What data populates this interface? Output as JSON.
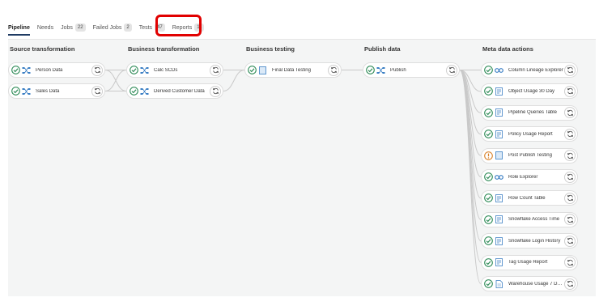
{
  "tabs": [
    {
      "label": "Pipeline",
      "badge": null
    },
    {
      "label": "Needs",
      "badge": null
    },
    {
      "label": "Jobs",
      "badge": "22"
    },
    {
      "label": "Failed Jobs",
      "badge": "2"
    },
    {
      "label": "Tests",
      "badge": "47"
    },
    {
      "label": "Reports",
      "badge": "11"
    }
  ],
  "columns": [
    {
      "title": "Source transformation"
    },
    {
      "title": "Business transformation"
    },
    {
      "title": "Business testing"
    },
    {
      "title": "Publish data"
    },
    {
      "title": "Meta data actions"
    }
  ],
  "nodes": [
    {
      "label": "Person Data",
      "status": "success",
      "icon": "transform-icon"
    },
    {
      "label": "Sales Data",
      "status": "success",
      "icon": "transform-icon"
    },
    {
      "label": "Calc SCDs",
      "status": "success",
      "icon": "transform-icon"
    },
    {
      "label": "Derived Customer Data",
      "status": "success",
      "icon": "transform-icon"
    },
    {
      "label": "Final Data Testing",
      "status": "success",
      "icon": "test-icon"
    },
    {
      "label": "Publish",
      "status": "success",
      "icon": "transform-icon"
    },
    {
      "label": "Column Lineage Explorer",
      "status": "success",
      "icon": "lineage-icon"
    },
    {
      "label": "Object Usage 30 Day",
      "status": "success",
      "icon": "report-icon"
    },
    {
      "label": "Pipeline Queries Table",
      "status": "success",
      "icon": "report-icon"
    },
    {
      "label": "Policy Usage Report",
      "status": "success",
      "icon": "report-icon"
    },
    {
      "label": "Post Publish Testing",
      "status": "warning",
      "icon": "test-icon"
    },
    {
      "label": "Role Explorer",
      "status": "success",
      "icon": "lineage-icon"
    },
    {
      "label": "Row Count Table",
      "status": "success",
      "icon": "report-icon"
    },
    {
      "label": "Snowflake Access Time",
      "status": "success",
      "icon": "report-icon"
    },
    {
      "label": "Snowflake Login History",
      "status": "success",
      "icon": "report-icon"
    },
    {
      "label": "Tag Usage Report",
      "status": "success",
      "icon": "report-icon"
    },
    {
      "label": "Warehouse Usage 7 Day V...",
      "status": "success",
      "icon": "document-icon"
    }
  ],
  "colors": {
    "success": "#2e8b57",
    "warning": "#d9822b",
    "icon_blue": "#3b7fc4",
    "link": "#c9c9c9",
    "highlight": "#e10000"
  }
}
